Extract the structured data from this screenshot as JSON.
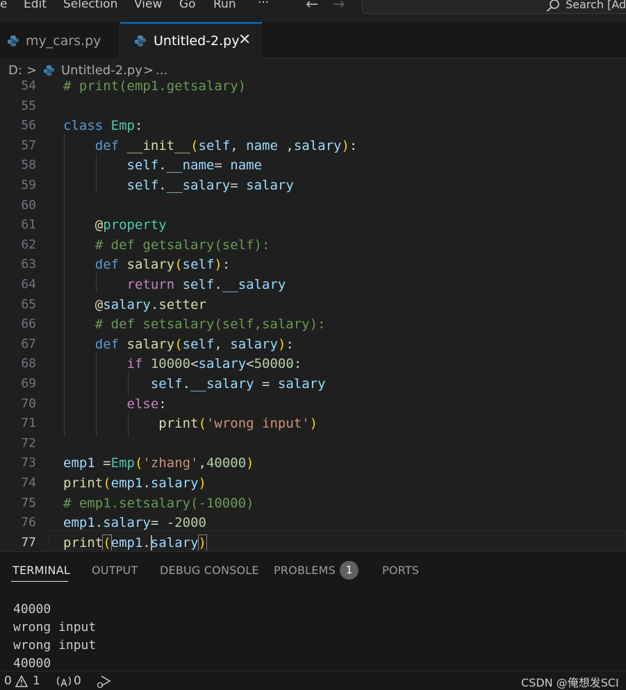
{
  "menubar": {
    "items": [
      "e",
      "Edit",
      "Selection",
      "View",
      "Go",
      "Run",
      "···"
    ],
    "search_placeholder": "Search [Ad"
  },
  "tabs": [
    {
      "label": "my_cars.py",
      "active": false
    },
    {
      "label": "Untitled-2.py",
      "active": true,
      "close": "✕"
    }
  ],
  "breadcrumb": {
    "drive": "D:",
    "sep": ">",
    "file": "Untitled-2.py",
    "more": "..."
  },
  "editor": {
    "active_line": 77,
    "line_numbers": [
      "54",
      "55",
      "56",
      "57",
      "58",
      "59",
      "60",
      "61",
      "62",
      "63",
      "64",
      "65",
      "66",
      "67",
      "68",
      "69",
      "70",
      "71",
      "72",
      "73",
      "74",
      "75",
      "76",
      "77"
    ]
  },
  "panel": {
    "tabs": [
      "TERMINAL",
      "OUTPUT",
      "DEBUG CONSOLE",
      "PROBLEMS",
      "PORTS"
    ],
    "problems_count": "1",
    "terminal_lines": [
      "40000",
      "wrong input",
      "wrong input",
      "40000"
    ]
  },
  "statusbar": {
    "errors": "0",
    "warnings": "1",
    "ports": "0",
    "watermark": "CSDN @俺想发SCI"
  },
  "colors": {
    "background": "#1f1f1f",
    "accent": "#0078d4",
    "keyword": "#569cd6",
    "comment": "#6a9955",
    "string": "#ce9178",
    "number": "#b5cea8",
    "class": "#4ec9b0",
    "function": "#dcdcaa",
    "variable": "#9cdcfe",
    "control": "#c586c0"
  }
}
